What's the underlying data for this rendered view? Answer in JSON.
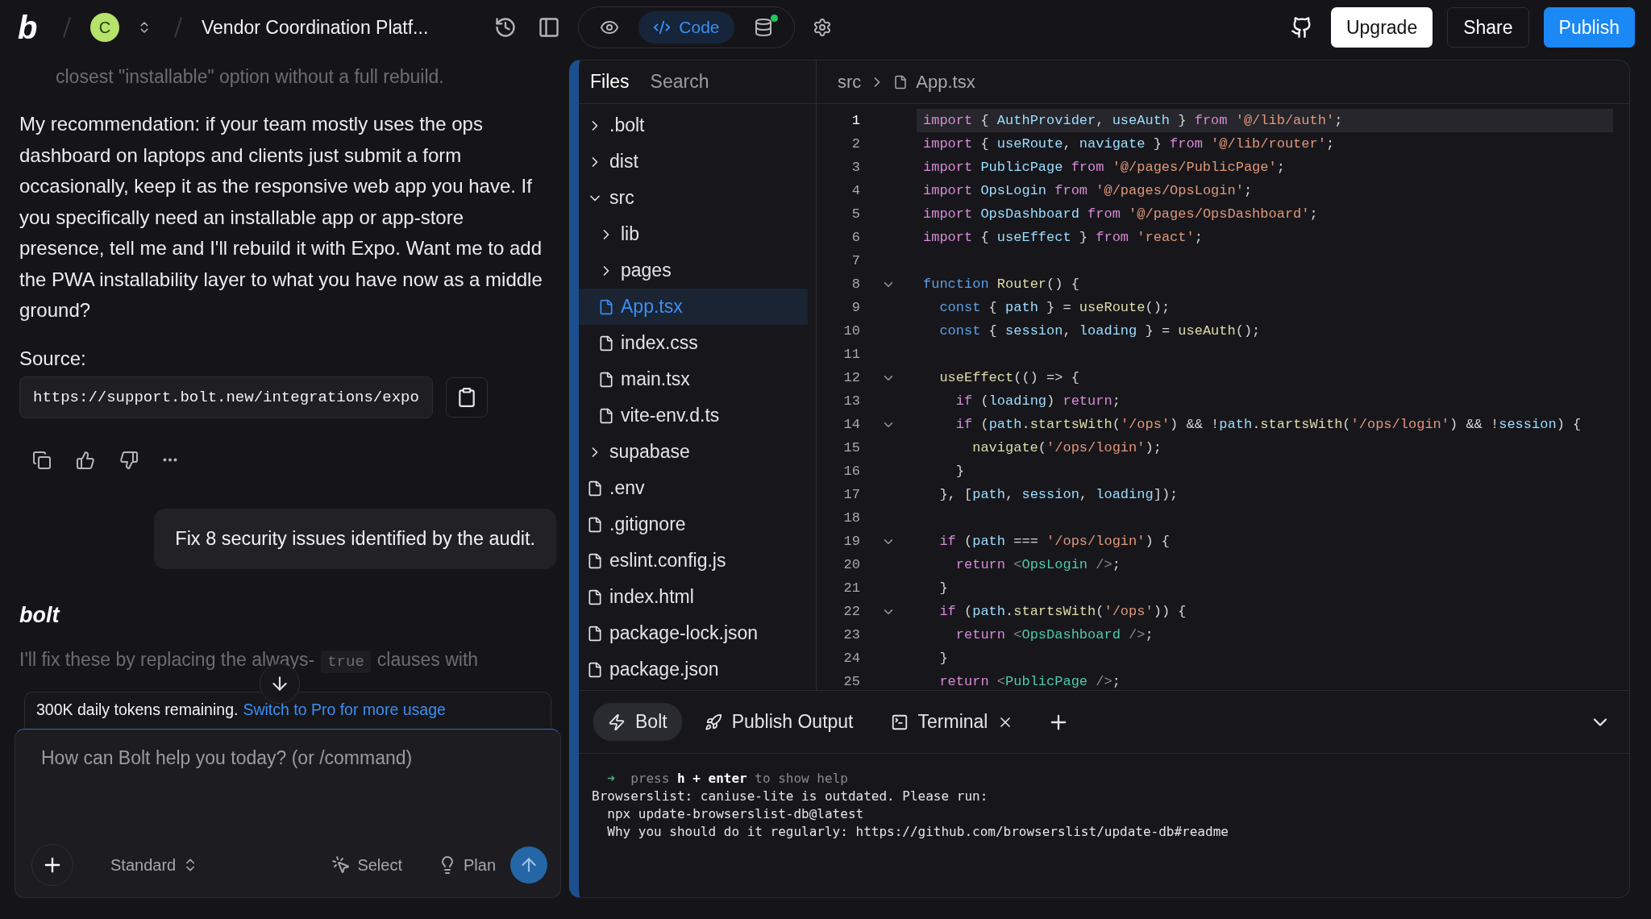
{
  "header": {
    "logo": "b",
    "avatar": "C",
    "project_title": "Vendor Coordination Platf...",
    "views": [
      {
        "kind": "preview",
        "selected": false,
        "online": false
      },
      {
        "kind": "code",
        "label": "Code",
        "selected": true,
        "online": false
      },
      {
        "kind": "database",
        "selected": false,
        "online": true
      }
    ],
    "buttons": [
      {
        "kind": "light",
        "label": "Upgrade"
      },
      {
        "kind": "dark",
        "label": "Share"
      },
      {
        "kind": "primary",
        "label": "Publish"
      }
    ]
  },
  "chat": {
    "faded_text": "closest \"installable\" option without a full rebuild.",
    "paragraph": "My recommendation: if your team mostly uses the ops dashboard on laptops and clients just submit a form occasionally, keep it as the responsive web app you have. If you specifically need an installable app or app-store presence, tell me and I'll rebuild it with Expo. Want me to add the PWA installability layer to what you have now as a middle ground?",
    "source_label": "Source:",
    "source_url": "https://support.bolt.new/integrations/expo",
    "user_message": "Fix 8 security issues identified by the audit.",
    "assistant_name": "bolt",
    "assistant_text": [
      {
        "kind": "text",
        "text": "I'll fix these by replacing the always-"
      },
      {
        "kind": "code",
        "text": "true"
      },
      {
        "kind": "text",
        "text": "clauses with"
      }
    ],
    "notice": {
      "text": "300K daily tokens remaining.",
      "link": "Switch to Pro for more usage"
    },
    "composer": {
      "placeholder": "How can Bolt help you today? (or /command)",
      "mode": "Standard",
      "select": "Select",
      "plan": "Plan"
    }
  },
  "workbench": {
    "tabs": [
      {
        "label": "Files",
        "selected": true
      },
      {
        "label": "Search",
        "selected": false
      }
    ],
    "tree": [
      {
        "name": ".bolt",
        "kind": "folder",
        "expanded": false,
        "selected": false
      },
      {
        "name": "dist",
        "kind": "folder",
        "expanded": false,
        "selected": false
      },
      {
        "name": "src",
        "kind": "folder",
        "expanded": true,
        "selected": false,
        "children": [
          {
            "name": "lib",
            "kind": "folder",
            "expanded": false,
            "selected": false
          },
          {
            "name": "pages",
            "kind": "folder",
            "expanded": false,
            "selected": false
          },
          {
            "name": "App.tsx",
            "kind": "file",
            "selected": true
          },
          {
            "name": "index.css",
            "kind": "file",
            "selected": false
          },
          {
            "name": "main.tsx",
            "kind": "file",
            "selected": false
          },
          {
            "name": "vite-env.d.ts",
            "kind": "file",
            "selected": false
          }
        ]
      },
      {
        "name": "supabase",
        "kind": "folder",
        "expanded": false,
        "selected": false
      },
      {
        "name": ".env",
        "kind": "file",
        "selected": false
      },
      {
        "name": ".gitignore",
        "kind": "file",
        "selected": false
      },
      {
        "name": "eslint.config.js",
        "kind": "file",
        "selected": false
      },
      {
        "name": "index.html",
        "kind": "file",
        "selected": false
      },
      {
        "name": "package-lock.json",
        "kind": "file",
        "selected": false
      },
      {
        "name": "package.json",
        "kind": "file",
        "selected": false
      }
    ],
    "breadcrumb": [
      "src",
      "App.tsx"
    ],
    "code": [
      {
        "number": "1",
        "fold": false,
        "active": true,
        "tokens": [
          {
            "kind": "kw",
            "text": "import"
          },
          {
            "kind": "p",
            "text": " { "
          },
          {
            "kind": "id",
            "text": "AuthProvider"
          },
          {
            "kind": "p",
            "text": ", "
          },
          {
            "kind": "id",
            "text": "useAuth"
          },
          {
            "kind": "p",
            "text": " } "
          },
          {
            "kind": "kw",
            "text": "from"
          },
          {
            "kind": "str",
            "text": " '@/lib/auth'"
          },
          {
            "kind": "p",
            "text": ";"
          }
        ]
      },
      {
        "number": "2",
        "fold": false,
        "active": false,
        "tokens": [
          {
            "kind": "kw",
            "text": "import"
          },
          {
            "kind": "p",
            "text": " { "
          },
          {
            "kind": "id",
            "text": "useRoute"
          },
          {
            "kind": "p",
            "text": ", "
          },
          {
            "kind": "id",
            "text": "navigate"
          },
          {
            "kind": "p",
            "text": " } "
          },
          {
            "kind": "kw",
            "text": "from"
          },
          {
            "kind": "str",
            "text": " '@/lib/router'"
          },
          {
            "kind": "p",
            "text": ";"
          }
        ]
      },
      {
        "number": "3",
        "fold": false,
        "active": false,
        "tokens": [
          {
            "kind": "kw",
            "text": "import"
          },
          {
            "kind": "id",
            "text": " PublicPage"
          },
          {
            "kind": "kw",
            "text": " from"
          },
          {
            "kind": "str",
            "text": " '@/pages/PublicPage'"
          },
          {
            "kind": "p",
            "text": ";"
          }
        ]
      },
      {
        "number": "4",
        "fold": false,
        "active": false,
        "tokens": [
          {
            "kind": "kw",
            "text": "import"
          },
          {
            "kind": "id",
            "text": " OpsLogin"
          },
          {
            "kind": "kw",
            "text": " from"
          },
          {
            "kind": "str",
            "text": " '@/pages/OpsLogin'"
          },
          {
            "kind": "p",
            "text": ";"
          }
        ]
      },
      {
        "number": "5",
        "fold": false,
        "active": false,
        "tokens": [
          {
            "kind": "kw",
            "text": "import"
          },
          {
            "kind": "id",
            "text": " OpsDashboard"
          },
          {
            "kind": "kw",
            "text": " from"
          },
          {
            "kind": "str",
            "text": " '@/pages/OpsDashboard'"
          },
          {
            "kind": "p",
            "text": ";"
          }
        ]
      },
      {
        "number": "6",
        "fold": false,
        "active": false,
        "tokens": [
          {
            "kind": "kw",
            "text": "import"
          },
          {
            "kind": "p",
            "text": " { "
          },
          {
            "kind": "id",
            "text": "useEffect"
          },
          {
            "kind": "p",
            "text": " } "
          },
          {
            "kind": "kw",
            "text": "from"
          },
          {
            "kind": "str",
            "text": " 'react'"
          },
          {
            "kind": "p",
            "text": ";"
          }
        ]
      },
      {
        "number": "7",
        "fold": false,
        "active": false
      },
      {
        "number": "8",
        "fold": true,
        "active": false,
        "tokens": [
          {
            "kind": "decl",
            "text": "function"
          },
          {
            "kind": "fn",
            "text": " Router"
          },
          {
            "kind": "p",
            "text": "() {"
          }
        ]
      },
      {
        "number": "9",
        "fold": false,
        "active": false,
        "tokens": [
          {
            "kind": "decl",
            "text": "  const"
          },
          {
            "kind": "p",
            "text": " { "
          },
          {
            "kind": "id",
            "text": "path"
          },
          {
            "kind": "p",
            "text": " } = "
          },
          {
            "kind": "fn",
            "text": "useRoute"
          },
          {
            "kind": "p",
            "text": "();"
          }
        ]
      },
      {
        "number": "10",
        "fold": false,
        "active": false,
        "tokens": [
          {
            "kind": "decl",
            "text": "  const"
          },
          {
            "kind": "p",
            "text": " { "
          },
          {
            "kind": "id",
            "text": "session"
          },
          {
            "kind": "p",
            "text": ", "
          },
          {
            "kind": "id",
            "text": "loading"
          },
          {
            "kind": "p",
            "text": " } = "
          },
          {
            "kind": "fn",
            "text": "useAuth"
          },
          {
            "kind": "p",
            "text": "();"
          }
        ]
      },
      {
        "number": "11",
        "fold": false,
        "active": false
      },
      {
        "number": "12",
        "fold": true,
        "active": false,
        "tokens": [
          {
            "kind": "fn",
            "text": "  useEffect"
          },
          {
            "kind": "p",
            "text": "(() => {"
          }
        ]
      },
      {
        "number": "13",
        "fold": false,
        "active": false,
        "tokens": [
          {
            "kind": "kw",
            "text": "    if"
          },
          {
            "kind": "p",
            "text": " ("
          },
          {
            "kind": "id",
            "text": "loading"
          },
          {
            "kind": "p",
            "text": ") "
          },
          {
            "kind": "kw",
            "text": "return"
          },
          {
            "kind": "p",
            "text": ";"
          }
        ]
      },
      {
        "number": "14",
        "fold": true,
        "active": false,
        "tokens": [
          {
            "kind": "kw",
            "text": "    if"
          },
          {
            "kind": "p",
            "text": " ("
          },
          {
            "kind": "id",
            "text": "path"
          },
          {
            "kind": "p",
            "text": "."
          },
          {
            "kind": "fn",
            "text": "startsWith"
          },
          {
            "kind": "p",
            "text": "("
          },
          {
            "kind": "str",
            "text": "'/ops'"
          },
          {
            "kind": "p",
            "text": ") && !"
          },
          {
            "kind": "id",
            "text": "path"
          },
          {
            "kind": "p",
            "text": "."
          },
          {
            "kind": "fn",
            "text": "startsWith"
          },
          {
            "kind": "p",
            "text": "("
          },
          {
            "kind": "str",
            "text": "'/ops/login'"
          },
          {
            "kind": "p",
            "text": ") && !"
          },
          {
            "kind": "id",
            "text": "session"
          },
          {
            "kind": "p",
            "text": ") {"
          }
        ]
      },
      {
        "number": "15",
        "fold": false,
        "active": false,
        "tokens": [
          {
            "kind": "fn",
            "text": "      navigate"
          },
          {
            "kind": "p",
            "text": "("
          },
          {
            "kind": "str",
            "text": "'/ops/login'"
          },
          {
            "kind": "p",
            "text": ");"
          }
        ]
      },
      {
        "number": "16",
        "fold": false,
        "active": false,
        "tokens": [
          {
            "kind": "p",
            "text": "    }"
          }
        ]
      },
      {
        "number": "17",
        "fold": false,
        "active": false,
        "tokens": [
          {
            "kind": "p",
            "text": "  }, ["
          },
          {
            "kind": "id",
            "text": "path"
          },
          {
            "kind": "p",
            "text": ", "
          },
          {
            "kind": "id",
            "text": "session"
          },
          {
            "kind": "p",
            "text": ", "
          },
          {
            "kind": "id",
            "text": "loading"
          },
          {
            "kind": "p",
            "text": "]);"
          }
        ]
      },
      {
        "number": "18",
        "fold": false,
        "active": false
      },
      {
        "number": "19",
        "fold": true,
        "active": false,
        "tokens": [
          {
            "kind": "kw",
            "text": "  if"
          },
          {
            "kind": "p",
            "text": " ("
          },
          {
            "kind": "id",
            "text": "path"
          },
          {
            "kind": "p",
            "text": " === "
          },
          {
            "kind": "str",
            "text": "'/ops/login'"
          },
          {
            "kind": "p",
            "text": ") {"
          }
        ]
      },
      {
        "number": "20",
        "fold": false,
        "active": false,
        "tokens": [
          {
            "kind": "kw",
            "text": "    return"
          },
          {
            "kind": "dim",
            "text": " <"
          },
          {
            "kind": "tag",
            "text": "OpsLogin"
          },
          {
            "kind": "dim",
            "text": " />"
          },
          {
            "kind": "p",
            "text": ";"
          }
        ]
      },
      {
        "number": "21",
        "fold": false,
        "active": false,
        "tokens": [
          {
            "kind": "p",
            "text": "  }"
          }
        ]
      },
      {
        "number": "22",
        "fold": true,
        "active": false,
        "tokens": [
          {
            "kind": "kw",
            "text": "  if"
          },
          {
            "kind": "p",
            "text": " ("
          },
          {
            "kind": "id",
            "text": "path"
          },
          {
            "kind": "p",
            "text": "."
          },
          {
            "kind": "fn",
            "text": "startsWith"
          },
          {
            "kind": "p",
            "text": "("
          },
          {
            "kind": "str",
            "text": "'/ops'"
          },
          {
            "kind": "p",
            "text": ")) {"
          }
        ]
      },
      {
        "number": "23",
        "fold": false,
        "active": false,
        "tokens": [
          {
            "kind": "kw",
            "text": "    return"
          },
          {
            "kind": "dim",
            "text": " <"
          },
          {
            "kind": "tag",
            "text": "OpsDashboard"
          },
          {
            "kind": "dim",
            "text": " />"
          },
          {
            "kind": "p",
            "text": ";"
          }
        ]
      },
      {
        "number": "24",
        "fold": false,
        "active": false,
        "tokens": [
          {
            "kind": "p",
            "text": "  }"
          }
        ]
      },
      {
        "number": "25",
        "fold": false,
        "active": false,
        "tokens": [
          {
            "kind": "kw",
            "text": "  return"
          },
          {
            "kind": "dim",
            "text": " <"
          },
          {
            "kind": "tag",
            "text": "PublicPage"
          },
          {
            "kind": "dim",
            "text": " />"
          },
          {
            "kind": "p",
            "text": ";"
          }
        ]
      }
    ],
    "panel_tabs": [
      {
        "kind": "bolt",
        "label": "Bolt",
        "selected": true,
        "closable": false
      },
      {
        "kind": "publish",
        "label": "Publish Output",
        "selected": false,
        "closable": false
      },
      {
        "kind": "terminal",
        "label": "Terminal",
        "selected": false,
        "closable": true
      }
    ],
    "terminal": [
      [
        {
          "kind": "arrow",
          "text": "  ➜"
        },
        {
          "kind": "dim",
          "text": "  press "
        },
        {
          "kind": "bold",
          "text": "h + enter"
        },
        {
          "kind": "dim",
          "text": " to show help"
        }
      ],
      [
        {
          "kind": "plain",
          "text": "Browserslist: caniuse-lite is outdated. Please run:"
        }
      ],
      [
        {
          "kind": "plain",
          "text": "  npx update-browserslist-db@latest"
        }
      ],
      [
        {
          "kind": "plain",
          "text": "  Why you should do it regularly: https://github.com/browserslist/update-db#readme"
        }
      ]
    ]
  }
}
